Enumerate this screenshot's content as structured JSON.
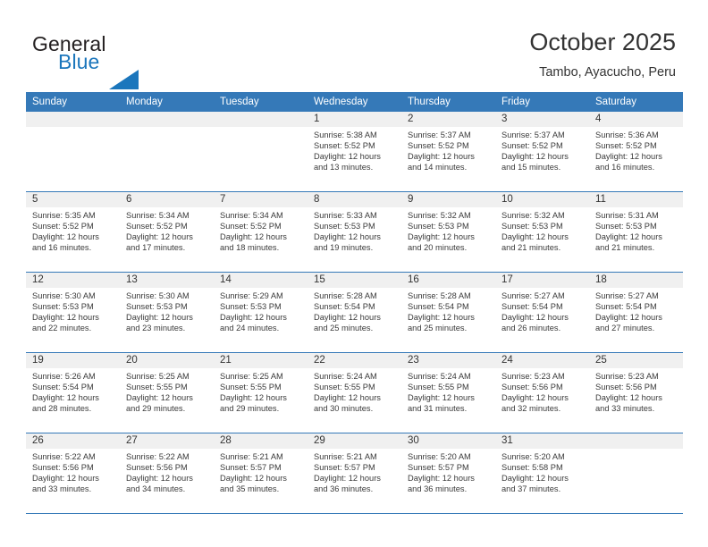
{
  "logo": {
    "text_top": "General",
    "text_bottom": "Blue",
    "accent_color": "#1b76bc",
    "triangle_icon": "triangle-icon"
  },
  "header": {
    "title": "October 2025",
    "subtitle": "Tambo, Ayacucho, Peru"
  },
  "calendar": {
    "header_color": "#3579b8",
    "weekdays": [
      "Sunday",
      "Monday",
      "Tuesday",
      "Wednesday",
      "Thursday",
      "Friday",
      "Saturday"
    ],
    "weeks": [
      [
        {
          "day": "",
          "empty": true
        },
        {
          "day": "",
          "empty": true
        },
        {
          "day": "",
          "empty": true
        },
        {
          "day": "1",
          "sunrise": "Sunrise: 5:38 AM",
          "sunset": "Sunset: 5:52 PM",
          "daylight_1": "Daylight: 12 hours",
          "daylight_2": "and 13 minutes."
        },
        {
          "day": "2",
          "sunrise": "Sunrise: 5:37 AM",
          "sunset": "Sunset: 5:52 PM",
          "daylight_1": "Daylight: 12 hours",
          "daylight_2": "and 14 minutes."
        },
        {
          "day": "3",
          "sunrise": "Sunrise: 5:37 AM",
          "sunset": "Sunset: 5:52 PM",
          "daylight_1": "Daylight: 12 hours",
          "daylight_2": "and 15 minutes."
        },
        {
          "day": "4",
          "sunrise": "Sunrise: 5:36 AM",
          "sunset": "Sunset: 5:52 PM",
          "daylight_1": "Daylight: 12 hours",
          "daylight_2": "and 16 minutes."
        }
      ],
      [
        {
          "day": "5",
          "sunrise": "Sunrise: 5:35 AM",
          "sunset": "Sunset: 5:52 PM",
          "daylight_1": "Daylight: 12 hours",
          "daylight_2": "and 16 minutes."
        },
        {
          "day": "6",
          "sunrise": "Sunrise: 5:34 AM",
          "sunset": "Sunset: 5:52 PM",
          "daylight_1": "Daylight: 12 hours",
          "daylight_2": "and 17 minutes."
        },
        {
          "day": "7",
          "sunrise": "Sunrise: 5:34 AM",
          "sunset": "Sunset: 5:52 PM",
          "daylight_1": "Daylight: 12 hours",
          "daylight_2": "and 18 minutes."
        },
        {
          "day": "8",
          "sunrise": "Sunrise: 5:33 AM",
          "sunset": "Sunset: 5:53 PM",
          "daylight_1": "Daylight: 12 hours",
          "daylight_2": "and 19 minutes."
        },
        {
          "day": "9",
          "sunrise": "Sunrise: 5:32 AM",
          "sunset": "Sunset: 5:53 PM",
          "daylight_1": "Daylight: 12 hours",
          "daylight_2": "and 20 minutes."
        },
        {
          "day": "10",
          "sunrise": "Sunrise: 5:32 AM",
          "sunset": "Sunset: 5:53 PM",
          "daylight_1": "Daylight: 12 hours",
          "daylight_2": "and 21 minutes."
        },
        {
          "day": "11",
          "sunrise": "Sunrise: 5:31 AM",
          "sunset": "Sunset: 5:53 PM",
          "daylight_1": "Daylight: 12 hours",
          "daylight_2": "and 21 minutes."
        }
      ],
      [
        {
          "day": "12",
          "sunrise": "Sunrise: 5:30 AM",
          "sunset": "Sunset: 5:53 PM",
          "daylight_1": "Daylight: 12 hours",
          "daylight_2": "and 22 minutes."
        },
        {
          "day": "13",
          "sunrise": "Sunrise: 5:30 AM",
          "sunset": "Sunset: 5:53 PM",
          "daylight_1": "Daylight: 12 hours",
          "daylight_2": "and 23 minutes."
        },
        {
          "day": "14",
          "sunrise": "Sunrise: 5:29 AM",
          "sunset": "Sunset: 5:53 PM",
          "daylight_1": "Daylight: 12 hours",
          "daylight_2": "and 24 minutes."
        },
        {
          "day": "15",
          "sunrise": "Sunrise: 5:28 AM",
          "sunset": "Sunset: 5:54 PM",
          "daylight_1": "Daylight: 12 hours",
          "daylight_2": "and 25 minutes."
        },
        {
          "day": "16",
          "sunrise": "Sunrise: 5:28 AM",
          "sunset": "Sunset: 5:54 PM",
          "daylight_1": "Daylight: 12 hours",
          "daylight_2": "and 25 minutes."
        },
        {
          "day": "17",
          "sunrise": "Sunrise: 5:27 AM",
          "sunset": "Sunset: 5:54 PM",
          "daylight_1": "Daylight: 12 hours",
          "daylight_2": "and 26 minutes."
        },
        {
          "day": "18",
          "sunrise": "Sunrise: 5:27 AM",
          "sunset": "Sunset: 5:54 PM",
          "daylight_1": "Daylight: 12 hours",
          "daylight_2": "and 27 minutes."
        }
      ],
      [
        {
          "day": "19",
          "sunrise": "Sunrise: 5:26 AM",
          "sunset": "Sunset: 5:54 PM",
          "daylight_1": "Daylight: 12 hours",
          "daylight_2": "and 28 minutes."
        },
        {
          "day": "20",
          "sunrise": "Sunrise: 5:25 AM",
          "sunset": "Sunset: 5:55 PM",
          "daylight_1": "Daylight: 12 hours",
          "daylight_2": "and 29 minutes."
        },
        {
          "day": "21",
          "sunrise": "Sunrise: 5:25 AM",
          "sunset": "Sunset: 5:55 PM",
          "daylight_1": "Daylight: 12 hours",
          "daylight_2": "and 29 minutes."
        },
        {
          "day": "22",
          "sunrise": "Sunrise: 5:24 AM",
          "sunset": "Sunset: 5:55 PM",
          "daylight_1": "Daylight: 12 hours",
          "daylight_2": "and 30 minutes."
        },
        {
          "day": "23",
          "sunrise": "Sunrise: 5:24 AM",
          "sunset": "Sunset: 5:55 PM",
          "daylight_1": "Daylight: 12 hours",
          "daylight_2": "and 31 minutes."
        },
        {
          "day": "24",
          "sunrise": "Sunrise: 5:23 AM",
          "sunset": "Sunset: 5:56 PM",
          "daylight_1": "Daylight: 12 hours",
          "daylight_2": "and 32 minutes."
        },
        {
          "day": "25",
          "sunrise": "Sunrise: 5:23 AM",
          "sunset": "Sunset: 5:56 PM",
          "daylight_1": "Daylight: 12 hours",
          "daylight_2": "and 33 minutes."
        }
      ],
      [
        {
          "day": "26",
          "sunrise": "Sunrise: 5:22 AM",
          "sunset": "Sunset: 5:56 PM",
          "daylight_1": "Daylight: 12 hours",
          "daylight_2": "and 33 minutes."
        },
        {
          "day": "27",
          "sunrise": "Sunrise: 5:22 AM",
          "sunset": "Sunset: 5:56 PM",
          "daylight_1": "Daylight: 12 hours",
          "daylight_2": "and 34 minutes."
        },
        {
          "day": "28",
          "sunrise": "Sunrise: 5:21 AM",
          "sunset": "Sunset: 5:57 PM",
          "daylight_1": "Daylight: 12 hours",
          "daylight_2": "and 35 minutes."
        },
        {
          "day": "29",
          "sunrise": "Sunrise: 5:21 AM",
          "sunset": "Sunset: 5:57 PM",
          "daylight_1": "Daylight: 12 hours",
          "daylight_2": "and 36 minutes."
        },
        {
          "day": "30",
          "sunrise": "Sunrise: 5:20 AM",
          "sunset": "Sunset: 5:57 PM",
          "daylight_1": "Daylight: 12 hours",
          "daylight_2": "and 36 minutes."
        },
        {
          "day": "31",
          "sunrise": "Sunrise: 5:20 AM",
          "sunset": "Sunset: 5:58 PM",
          "daylight_1": "Daylight: 12 hours",
          "daylight_2": "and 37 minutes."
        },
        {
          "day": "",
          "empty": true
        }
      ]
    ]
  }
}
